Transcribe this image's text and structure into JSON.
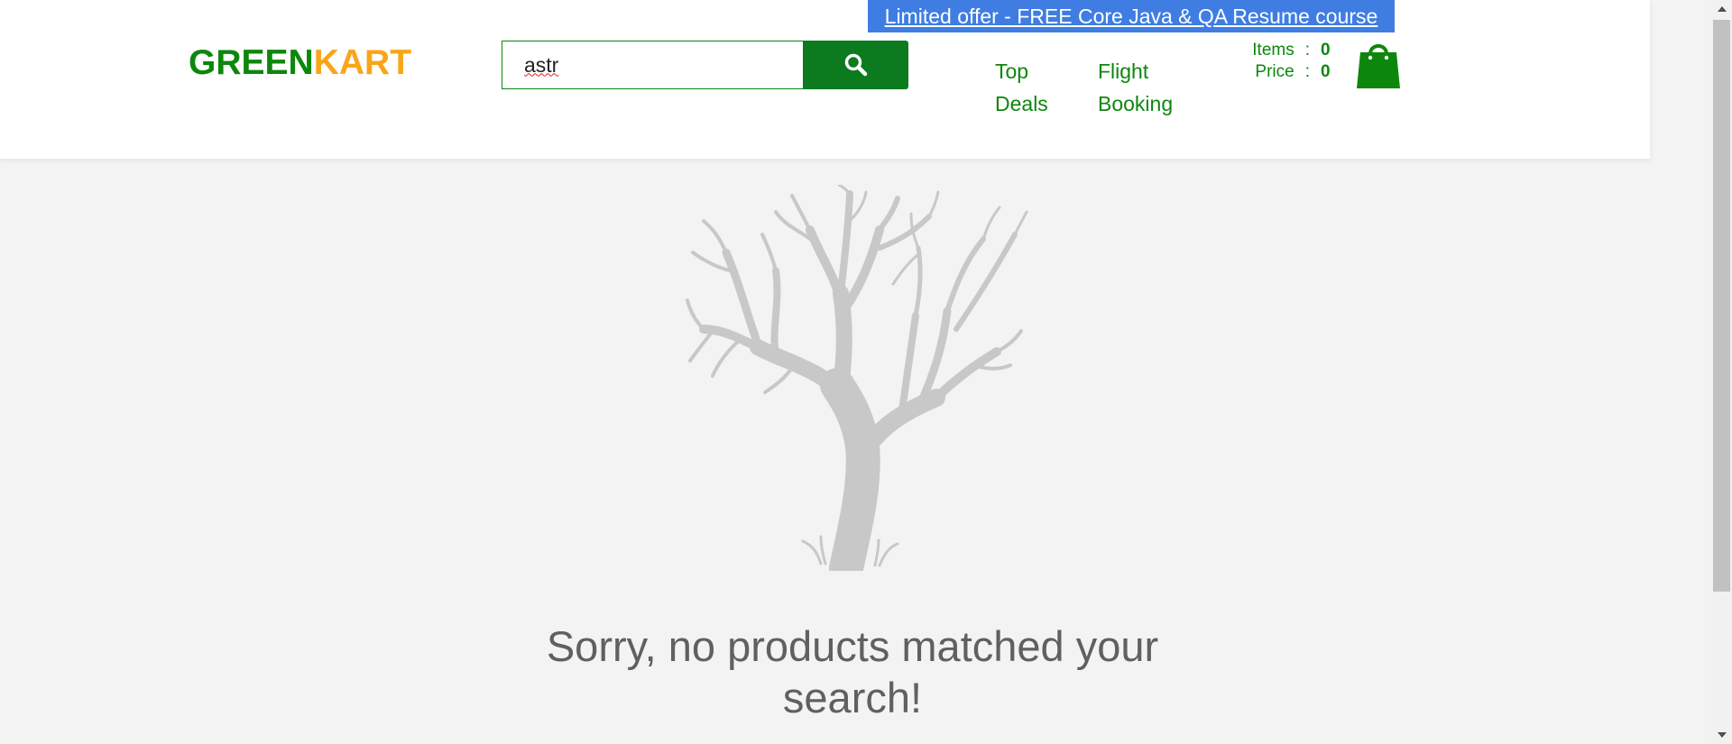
{
  "header": {
    "logo": {
      "part1": "GREEN",
      "part2": "KART"
    },
    "promo_link": "Limited offer - FREE Core Java & QA Resume course",
    "search": {
      "value": "astr",
      "button_icon": "search-icon"
    },
    "nav": [
      {
        "label_line1": "Top",
        "label_line2": "Deals"
      },
      {
        "label_line1": "Flight",
        "label_line2": "Booking"
      }
    ],
    "cart": {
      "items_label": "Items",
      "items_value": "0",
      "price_label": "Price",
      "price_value": "0",
      "separator": ":",
      "icon": "shopping-bag-icon"
    }
  },
  "main": {
    "illustration": "bare-tree-icon",
    "message": "Sorry, no products matched your search!"
  },
  "colors": {
    "brand_green": "#0c870c",
    "brand_orange": "#f9a51a",
    "promo_blue": "#3f7de3",
    "search_button": "#0c7a1f",
    "page_bg": "#f3f3f3",
    "message_text": "#606060"
  }
}
